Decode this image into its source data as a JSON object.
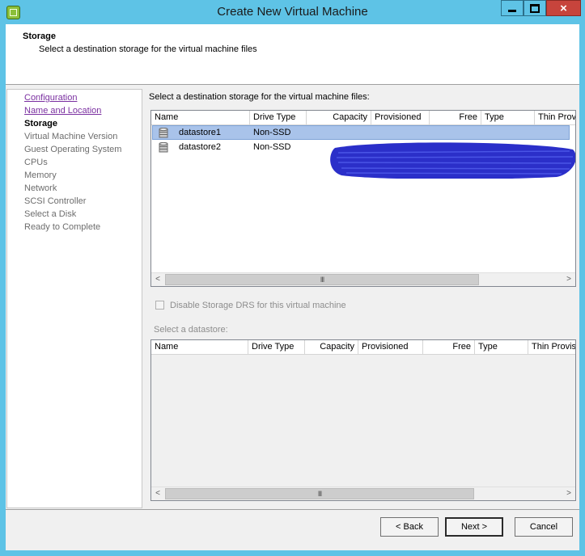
{
  "window": {
    "title": "Create New Virtual Machine",
    "controls": {
      "minimize": "minimize",
      "maximize": "maximize",
      "close": "×"
    }
  },
  "header": {
    "title": "Storage",
    "subtitle": "Select a destination storage for the virtual machine files"
  },
  "nav": {
    "items": [
      {
        "label": "Configuration",
        "state": "link"
      },
      {
        "label": "Name and Location",
        "state": "link"
      },
      {
        "label": "Storage",
        "state": "current"
      },
      {
        "label": "Virtual Machine Version",
        "state": "disabled"
      },
      {
        "label": "Guest Operating System",
        "state": "disabled"
      },
      {
        "label": "CPUs",
        "state": "disabled"
      },
      {
        "label": "Memory",
        "state": "disabled"
      },
      {
        "label": "Network",
        "state": "disabled"
      },
      {
        "label": "SCSI Controller",
        "state": "disabled"
      },
      {
        "label": "Select a Disk",
        "state": "disabled"
      },
      {
        "label": "Ready to Complete",
        "state": "disabled"
      }
    ]
  },
  "storage_table": {
    "label": "Select a destination storage for the virtual machine files:",
    "columns": [
      "Name",
      "Drive Type",
      "Capacity",
      "Provisioned",
      "Free",
      "Type",
      "Thin Prov"
    ],
    "rows": [
      {
        "name": "datastore1",
        "drive_type": "Non-SSD",
        "selected": true
      },
      {
        "name": "datastore2",
        "drive_type": "Non-SSD",
        "selected": false
      }
    ],
    "scroll_grip": "III"
  },
  "options": {
    "disable_drs_label": "Disable Storage DRS for this virtual machine",
    "disable_drs_checked": false,
    "select_datastore_label": "Select a datastore:"
  },
  "datastore_table": {
    "columns": [
      "Name",
      "Drive Type",
      "Capacity",
      "Provisioned",
      "Free",
      "Type",
      "Thin Provis"
    ],
    "scroll_grip": "III"
  },
  "buttons": {
    "back": "< Back",
    "next": "Next >",
    "cancel": "Cancel"
  },
  "colors": {
    "titlebar": "#5ec3e6",
    "selection": "#a9c3ea",
    "link": "#7a2fa0",
    "redaction": "#2b2fc9"
  }
}
